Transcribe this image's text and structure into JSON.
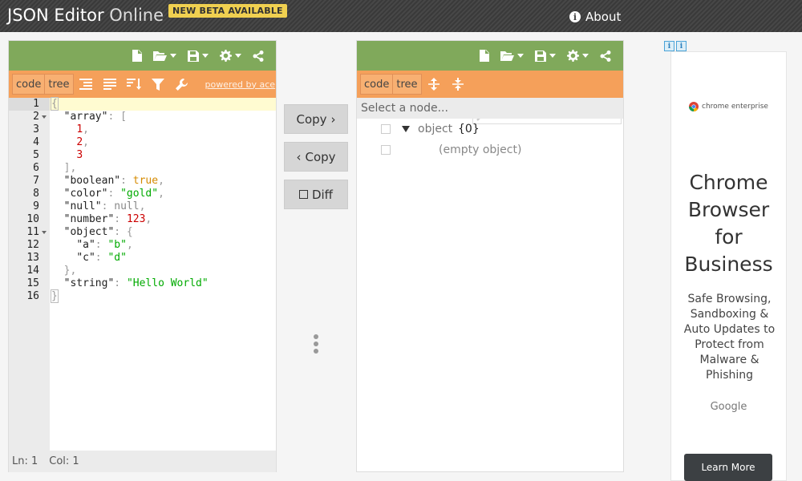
{
  "header": {
    "title_bold": "JSON Editor",
    "title_thin": "Online",
    "beta_badge": "NEW BETA AVAILABLE",
    "about_label": "About"
  },
  "left": {
    "mode_code": "code",
    "mode_tree": "tree",
    "powered_by": "powered by ace",
    "gutter": [
      "1",
      "2",
      "3",
      "4",
      "5",
      "6",
      "7",
      "8",
      "9",
      "10",
      "11",
      "12",
      "13",
      "14",
      "15",
      "16"
    ],
    "status_ln": "Ln: 1",
    "status_col": "Col: 1"
  },
  "code": {
    "l1": "{",
    "l2_key": "\"array\"",
    "l2_rest": ": [",
    "l3": "1",
    "l4": "2",
    "l5": "3",
    "l6": "],",
    "l7_key": "\"boolean\"",
    "l7_val": "true",
    "l8_key": "\"color\"",
    "l8_val": "\"gold\"",
    "l9_key": "\"null\"",
    "l9_val": "null",
    "l10_key": "\"number\"",
    "l10_val": "123",
    "l11_key": "\"object\"",
    "l11_rest": ": {",
    "l12_key": "\"a\"",
    "l12_val": "\"b\"",
    "l13_key": "\"c\"",
    "l13_val": "\"d\"",
    "l14": "},",
    "l15_key": "\"string\"",
    "l15_val": "\"Hello World\"",
    "l16": "}"
  },
  "middle": {
    "copy_right": "Copy",
    "copy_left": "Copy",
    "diff": "Diff"
  },
  "right": {
    "mode_code": "code",
    "mode_tree": "tree",
    "nav_placeholder": "Select a node...",
    "root_field": "object",
    "root_value": "{0}",
    "empty_label": "(empty object)"
  },
  "ad": {
    "brand": "chrome enterprise",
    "title_lines": [
      "Chrome",
      "Browser",
      "for",
      "Business"
    ],
    "body_lines": [
      "Safe Browsing,",
      "Sandboxing &",
      "Auto Updates to",
      "Protect from",
      "Malware &",
      "Phishing"
    ],
    "sponsor": "Google",
    "cta": "Learn More"
  },
  "colors": {
    "menu_green": "#80a95b",
    "toolbar_orange": "#f5a05a",
    "beta_yellow": "#f0d050"
  }
}
